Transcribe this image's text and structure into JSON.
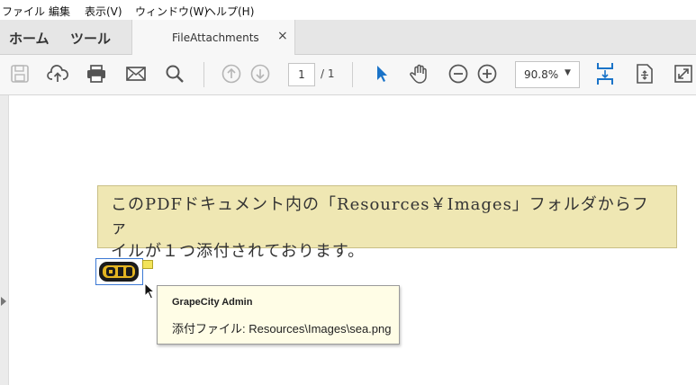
{
  "menu": {
    "items": [
      {
        "label": "ファイル"
      },
      {
        "label": "編集"
      },
      {
        "label": "表示(V)"
      },
      {
        "label": "ウィンドウ(W)"
      },
      {
        "label": "ヘルプ(H)"
      }
    ]
  },
  "tabs": {
    "home": "ホーム",
    "tools": "ツール",
    "document": "FileAttachments",
    "close": "×"
  },
  "toolbar": {
    "icons": [
      "save-icon",
      "upload-cloud-icon",
      "print-icon",
      "mail-icon",
      "search-icon",
      "previous-page-icon",
      "next-page-icon",
      "select-arrow-icon",
      "hand-icon",
      "zoom-out-icon",
      "zoom-in-icon",
      "scroll-mode-icon",
      "fit-page-icon",
      "full-screen-icon"
    ],
    "page_current": "1",
    "page_total": "/ 1",
    "zoom": "90.8%",
    "zoom_caret": "▼"
  },
  "document": {
    "note_line1": "このPDFドキュメント内の「Resources￥Images」フォルダからファ",
    "note_line2": "イルが１つ添付されております。",
    "note_color": "#efe7b3"
  },
  "tooltip": {
    "author": "GrapeCity Admin",
    "text": "添付ファイル: Resources\\Images\\sea.png"
  },
  "colors": {
    "accent": "#1a73c8",
    "selection_border": "#3b78d4"
  }
}
